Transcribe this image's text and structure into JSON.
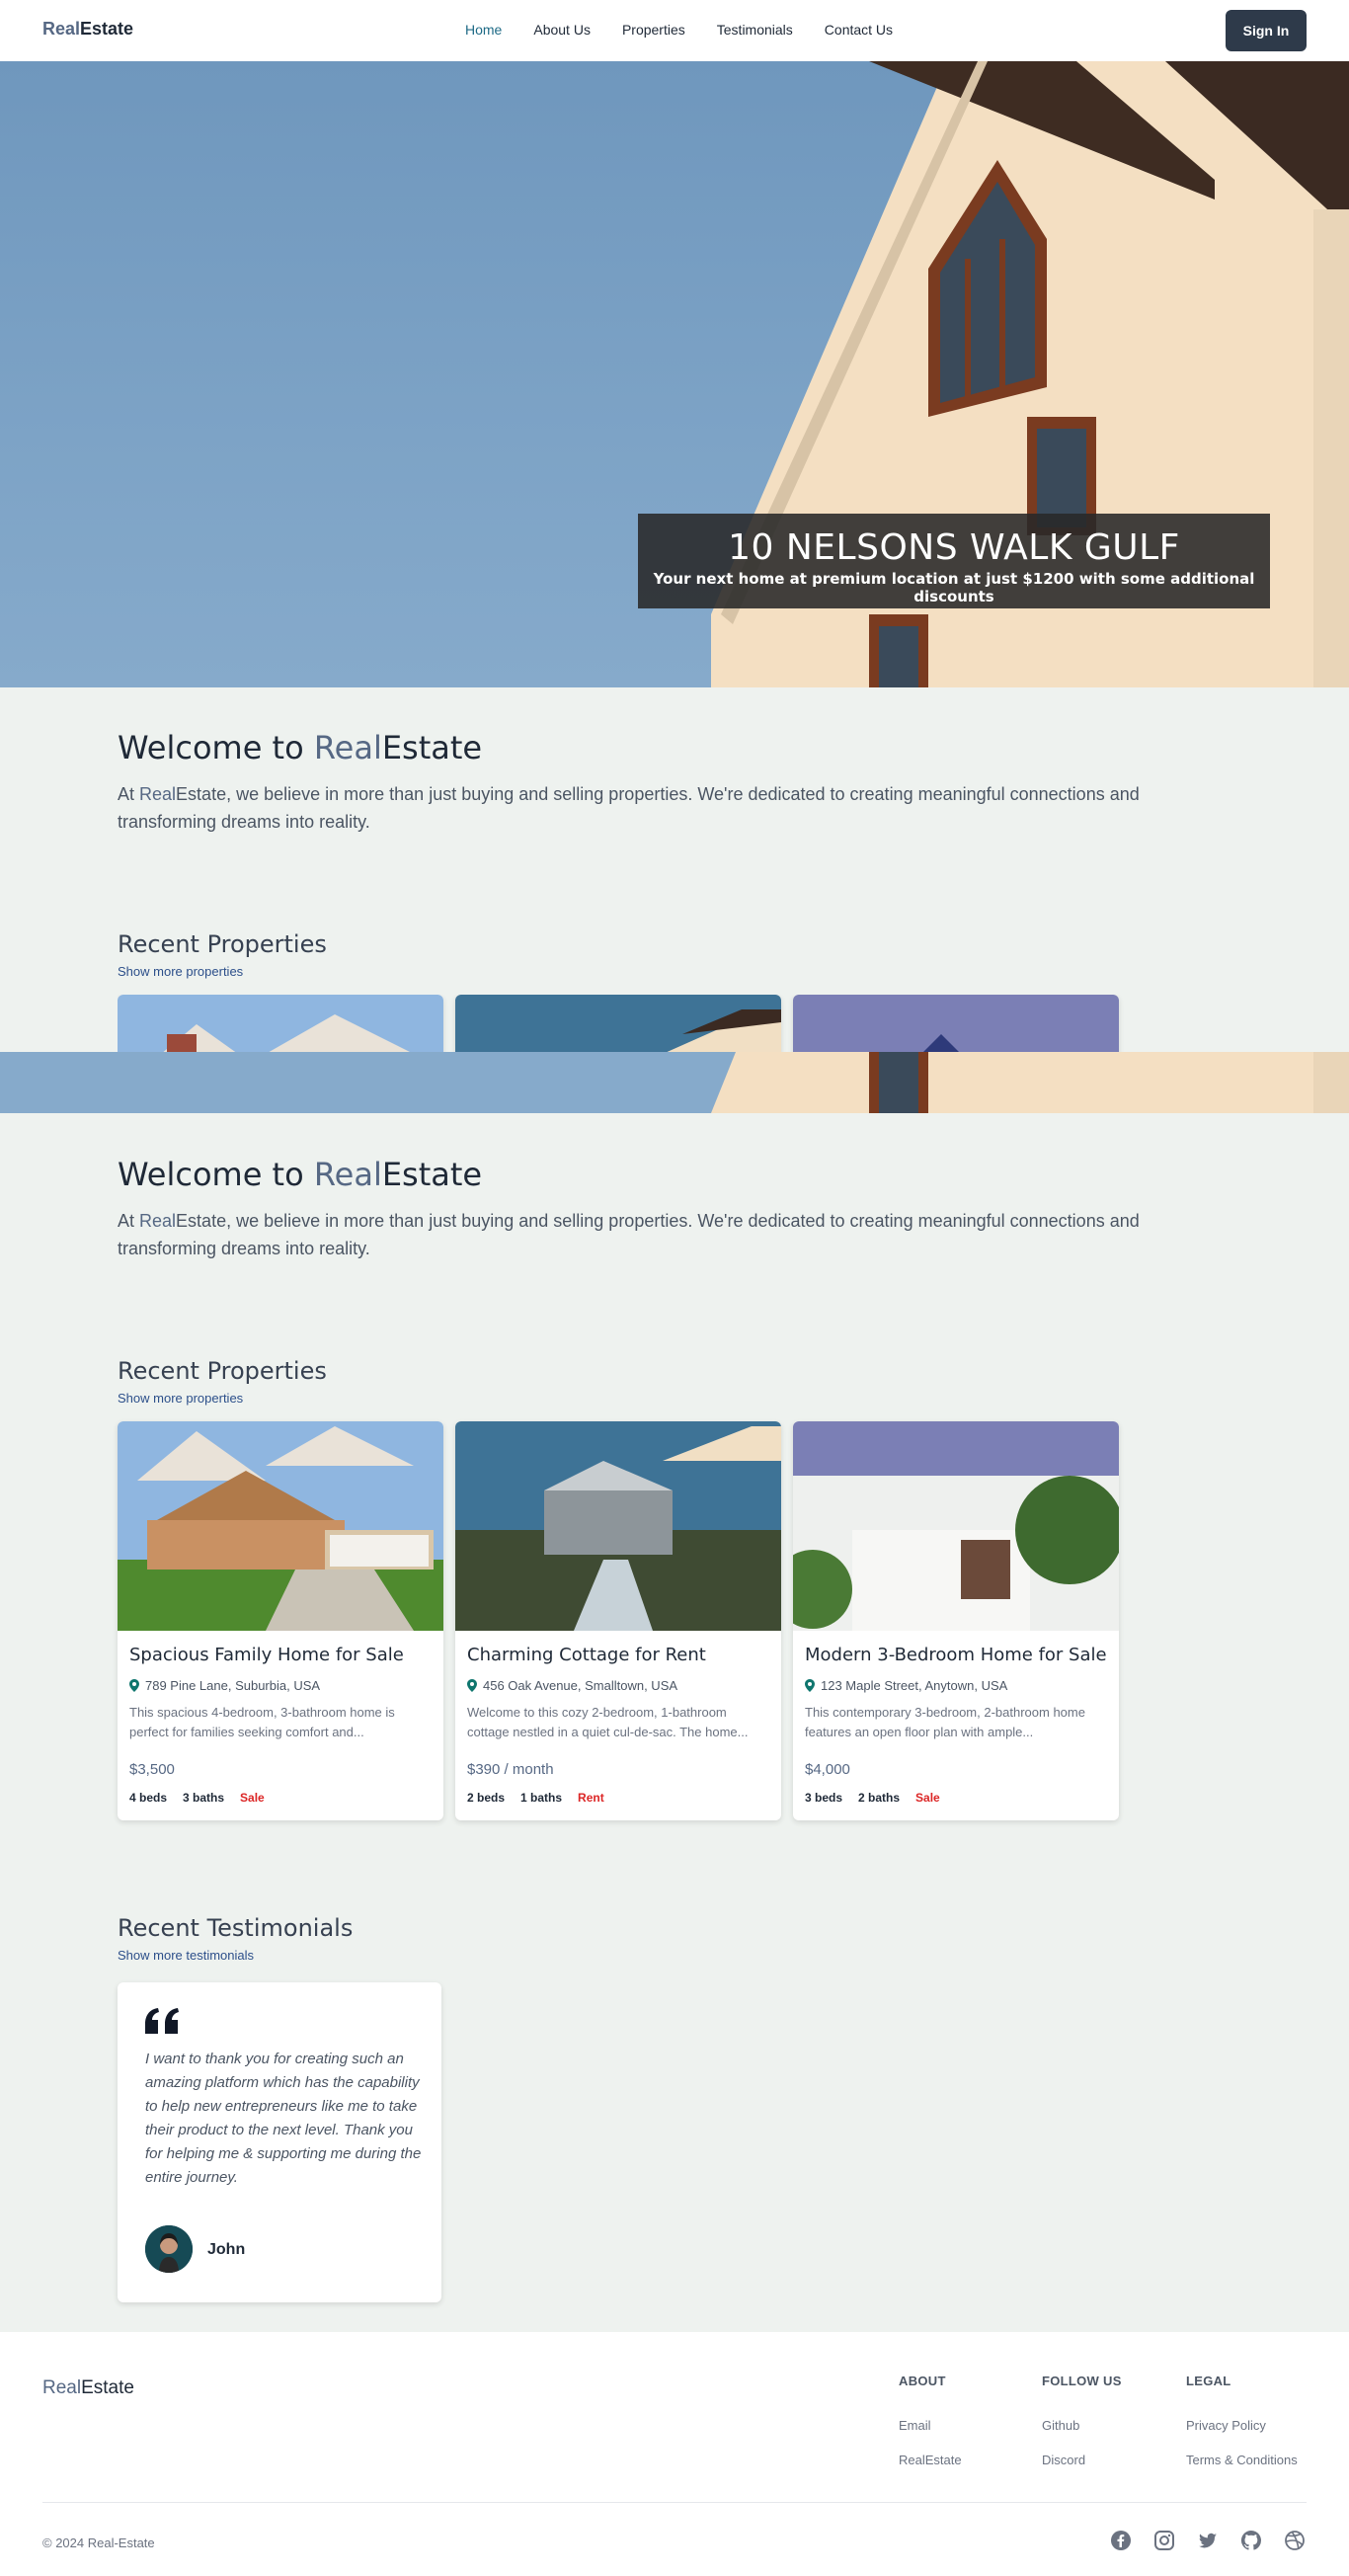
{
  "nav": {
    "logo_real": "Real",
    "logo_estate": "Estate",
    "links": [
      "Home",
      "About Us",
      "Properties",
      "Testimonials",
      "Contact Us"
    ],
    "signin_label": "Sign In"
  },
  "hero": {
    "title": "10 NELSONS WALK GULF",
    "subtitle": "Your next home at premium location at just $1200 with some additional discounts"
  },
  "welcome": {
    "title_prefix": "Welcome to ",
    "title_real": "Real",
    "title_estate": "Estate",
    "text_prefix": "At ",
    "text_real": "Real",
    "text_estate": "Estate",
    "text_rest": ", we believe in more than just buying and selling properties. We're dedicated to creating meaningful connections and transforming dreams into reality."
  },
  "recent_properties": {
    "title": "Recent Properties",
    "link": "Show more properties",
    "cards": [
      {
        "title": "Spacious Family Home for Sale",
        "address": "789 Pine Lane, Suburbia, USA",
        "description": "This spacious 4-bedroom, 3-bathroom home is perfect for families seeking comfort and...",
        "price": "$3,500",
        "beds": "4 beds",
        "baths": "3 baths",
        "tag": "Sale"
      },
      {
        "title": "Charming Cottage for Rent",
        "address": "456 Oak Avenue, Smalltown, USA",
        "description": "Welcome to this cozy 2-bedroom, 1-bathroom cottage nestled in a quiet cul-de-sac. The home...",
        "price": "$390 / month",
        "beds": "2 beds",
        "baths": "1 baths",
        "tag": "Rent"
      },
      {
        "title": "Modern 3-Bedroom Home for Sale",
        "address": "123 Maple Street, Anytown, USA",
        "description": "This contemporary 3-bedroom, 2-bathroom home features an open floor plan with ample...",
        "price": "$4,000",
        "beds": "3 beds",
        "baths": "2 baths",
        "tag": "Sale"
      }
    ]
  },
  "testimonials": {
    "title": "Recent Testimonials",
    "link": "Show more testimonials",
    "items": [
      {
        "quote": "I want to thank you for creating such an amazing platform which has the capability to help new entrepreneurs like me to take their product to the next level. Thank you for helping me & supporting me during the entire journey.",
        "name": "John"
      }
    ]
  },
  "footer": {
    "logo_real": "Real",
    "logo_estate": "Estate",
    "columns": [
      {
        "heading": "ABOUT",
        "links": [
          "Email",
          "RealEstate"
        ]
      },
      {
        "heading": "FOLLOW US",
        "links": [
          "Github",
          "Discord"
        ]
      },
      {
        "heading": "LEGAL",
        "links": [
          "Privacy Policy",
          "Terms & Conditions"
        ]
      }
    ],
    "copyright": "© 2024 Real-Estate",
    "socials": [
      "facebook-icon",
      "instagram-icon",
      "twitter-icon",
      "github-icon",
      "dribbble-icon"
    ]
  },
  "colors": {
    "accent": "#566884",
    "nav_active": "#1e6a86",
    "button": "#2e3a4a",
    "tag": "#dc2626",
    "link": "#2c4f8a",
    "page_bg": "#eef2ef"
  }
}
